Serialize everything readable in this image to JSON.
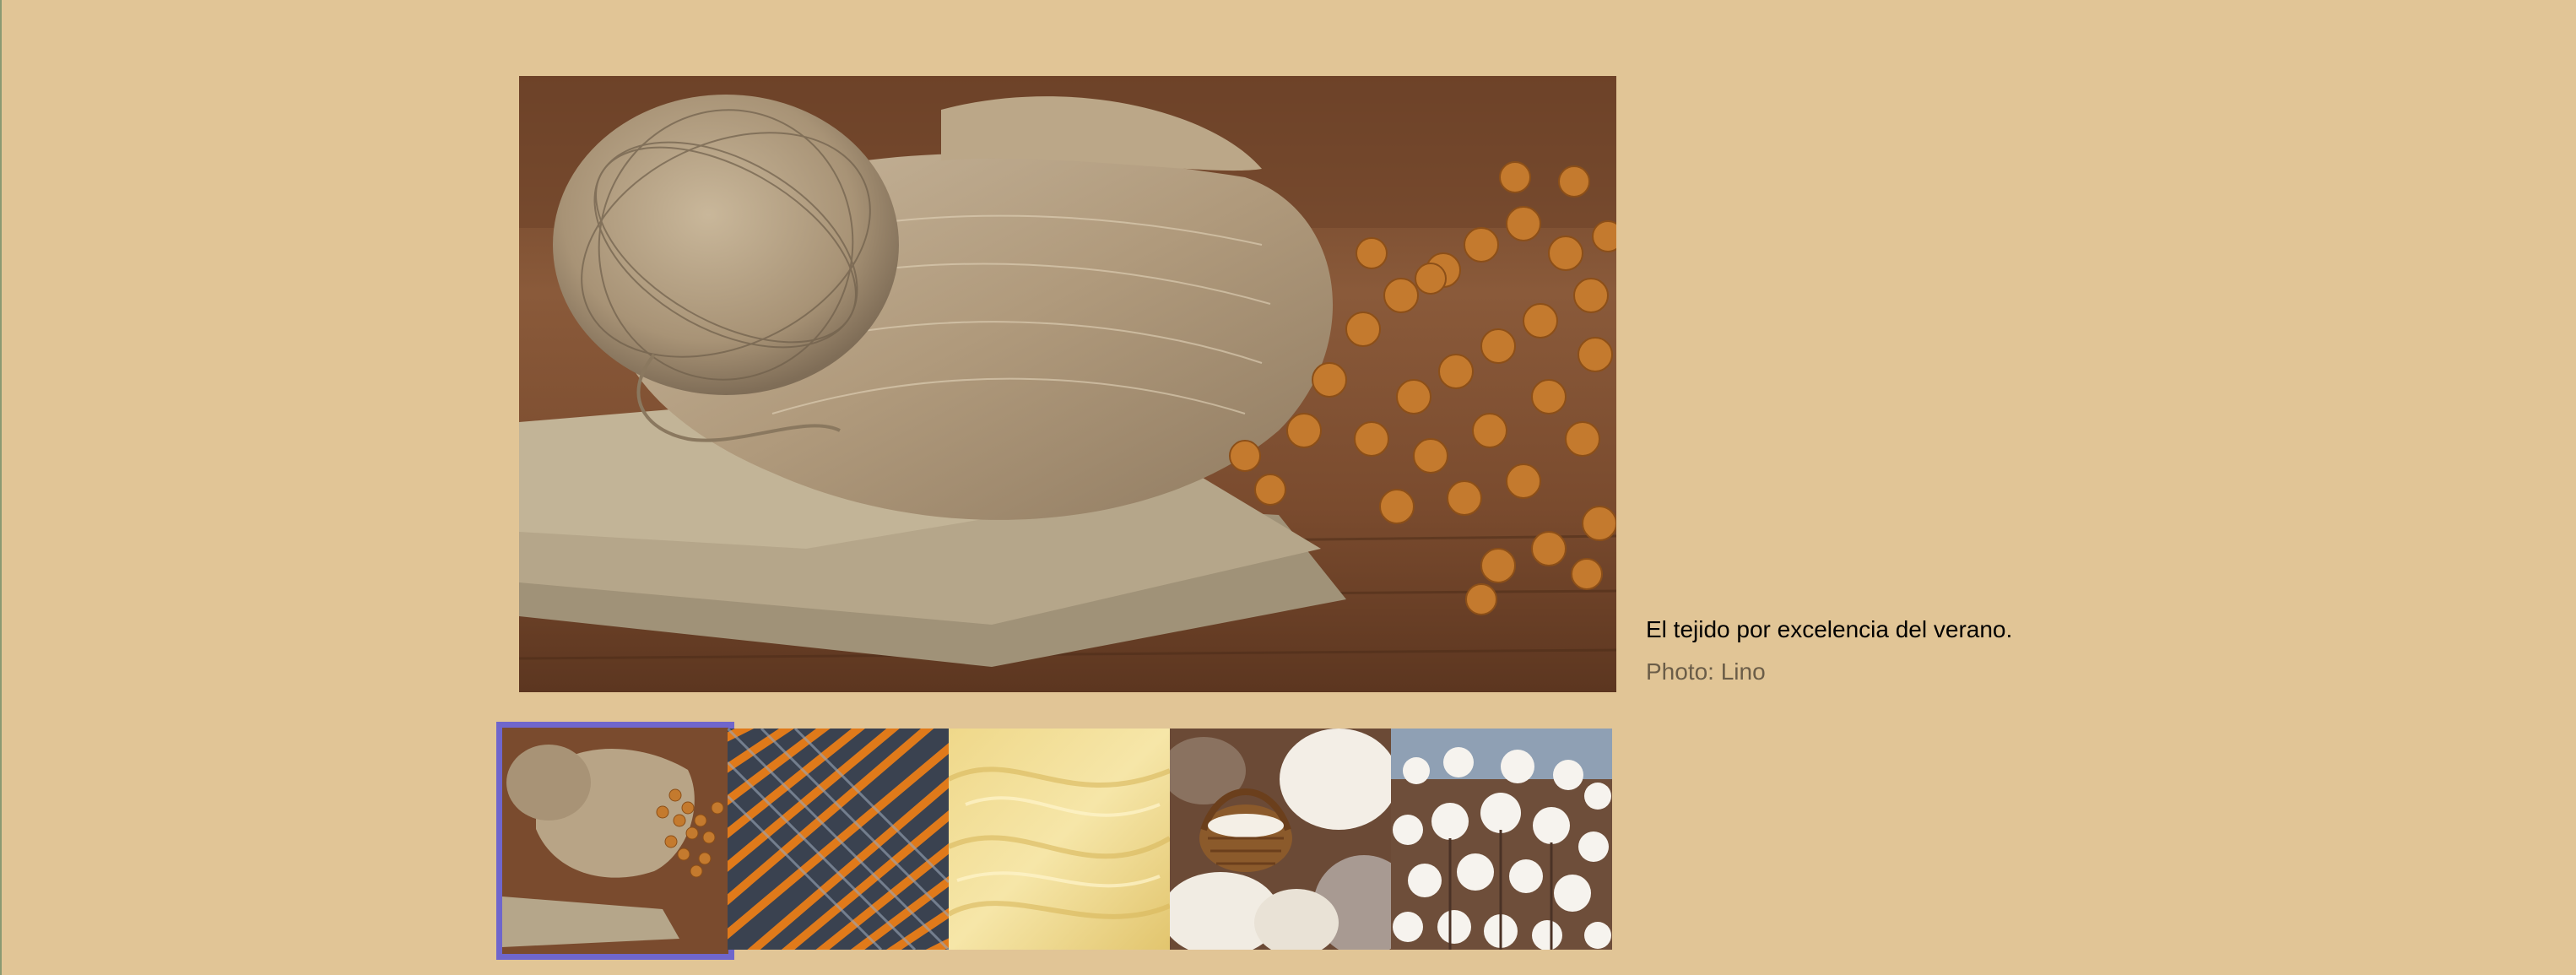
{
  "gallery": {
    "main_photo_icon": "linen-yarn-photo",
    "caption": "El tejido por excelencia del verano.",
    "credit": "Photo: Lino",
    "thumbnails": [
      {
        "icon": "linen-thumbnail",
        "selected": true
      },
      {
        "icon": "woven-fabric-thumbnail",
        "selected": false
      },
      {
        "icon": "yellow-silk-thumbnail",
        "selected": false
      },
      {
        "icon": "wool-basket-thumbnail",
        "selected": false
      },
      {
        "icon": "cotton-field-thumbnail",
        "selected": false
      }
    ]
  },
  "colors": {
    "background": "#e1c596",
    "selection_border": "#6f66cc"
  }
}
